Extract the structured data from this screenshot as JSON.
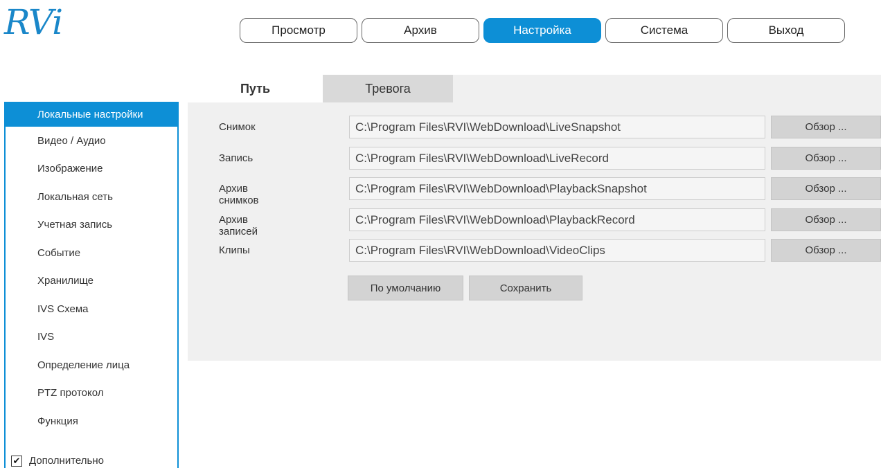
{
  "brand": {
    "logo_text": "RVi",
    "color": "#1a87c9"
  },
  "topnav": {
    "items": [
      {
        "label": "Просмотр",
        "active": false
      },
      {
        "label": "Архив",
        "active": false
      },
      {
        "label": "Настройка",
        "active": true
      },
      {
        "label": "Система",
        "active": false
      },
      {
        "label": "Выход",
        "active": false
      }
    ],
    "accent": "#0d8fd6"
  },
  "sidebar": {
    "items": [
      {
        "label": "Локальные настройки",
        "active": true
      },
      {
        "label": "Видео / Аудио"
      },
      {
        "label": "Изображение"
      },
      {
        "label": "Локальная сеть"
      },
      {
        "label": "Учетная запись"
      },
      {
        "label": "Событие"
      },
      {
        "label": "Хранилище"
      },
      {
        "label": "IVS Схема"
      },
      {
        "label": "IVS"
      },
      {
        "label": "Определение лица"
      },
      {
        "label": "PTZ протокол"
      },
      {
        "label": "Функция"
      }
    ],
    "extra": {
      "label": "Дополнительно",
      "checked": true
    }
  },
  "tabs": [
    {
      "label": "Путь",
      "active": true
    },
    {
      "label": "Тревога",
      "active": false
    }
  ],
  "paths": [
    {
      "label": "Снимок",
      "value": "C:\\Program Files\\RVI\\WebDownload\\LiveSnapshot",
      "browse": "Обзор ..."
    },
    {
      "label": "Запись",
      "value": "C:\\Program Files\\RVI\\WebDownload\\LiveRecord",
      "browse": "Обзор ..."
    },
    {
      "label": "Архив снимков",
      "value": "C:\\Program Files\\RVI\\WebDownload\\PlaybackSnapshot",
      "browse": "Обзор ..."
    },
    {
      "label": "Архив записей",
      "value": "C:\\Program Files\\RVI\\WebDownload\\PlaybackRecord",
      "browse": "Обзор ..."
    },
    {
      "label": "Клипы",
      "value": "C:\\Program Files\\RVI\\WebDownload\\VideoClips",
      "browse": "Обзор ..."
    }
  ],
  "actions": {
    "default_label": "По умолчанию",
    "save_label": "Сохранить"
  }
}
